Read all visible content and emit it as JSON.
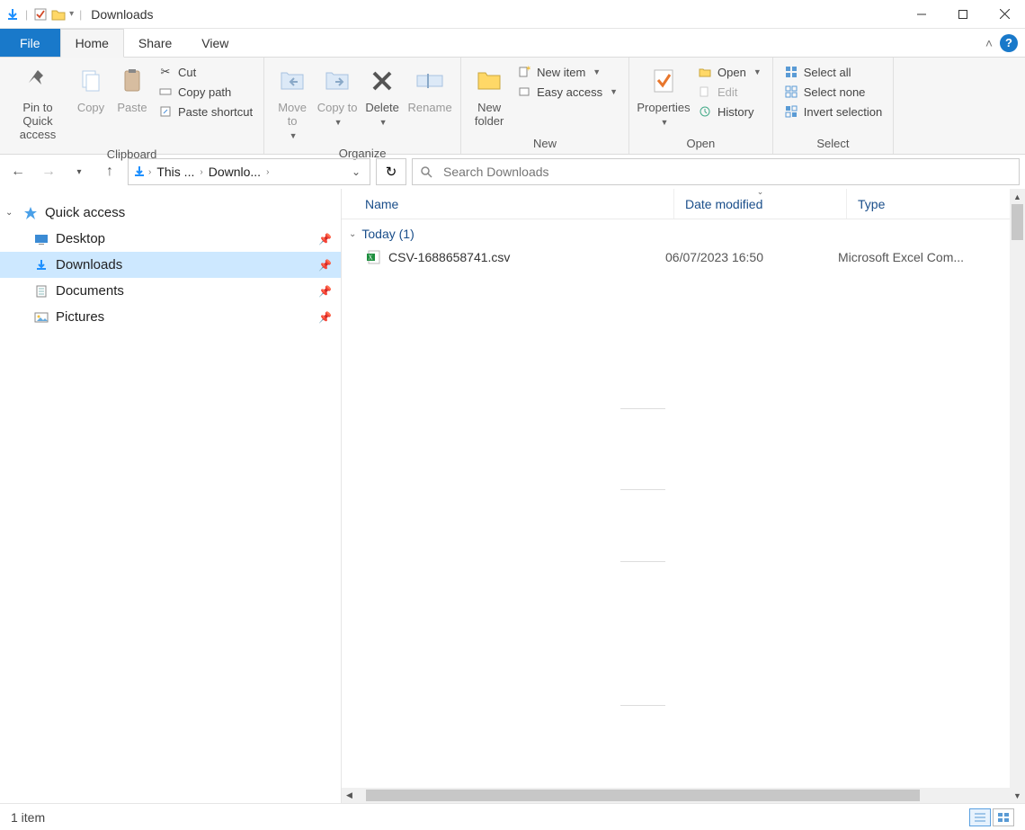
{
  "window": {
    "title": "Downloads"
  },
  "tabs": {
    "file": "File",
    "home": "Home",
    "share": "Share",
    "view": "View"
  },
  "ribbon": {
    "clipboard": {
      "label": "Clipboard",
      "pin": "Pin to Quick access",
      "copy": "Copy",
      "paste": "Paste",
      "cut": "Cut",
      "copypath": "Copy path",
      "pasteshortcut": "Paste shortcut"
    },
    "organize": {
      "label": "Organize",
      "moveto": "Move to",
      "copyto": "Copy to",
      "delete": "Delete",
      "rename": "Rename"
    },
    "new": {
      "label": "New",
      "newfolder": "New folder",
      "newitem": "New item",
      "easyaccess": "Easy access"
    },
    "open": {
      "label": "Open",
      "properties": "Properties",
      "open": "Open",
      "edit": "Edit",
      "history": "History"
    },
    "select": {
      "label": "Select",
      "selectall": "Select all",
      "selectnone": "Select none",
      "invert": "Invert selection"
    }
  },
  "breadcrumb": {
    "root": "This ...",
    "current": "Downlo..."
  },
  "search": {
    "placeholder": "Search Downloads"
  },
  "navpane": {
    "quickaccess": "Quick access",
    "desktop": "Desktop",
    "downloads": "Downloads",
    "documents": "Documents",
    "pictures": "Pictures"
  },
  "columns": {
    "name": "Name",
    "date": "Date modified",
    "type": "Type"
  },
  "group": {
    "label": "Today (1)"
  },
  "files": [
    {
      "name": "CSV-1688658741.csv",
      "date": "06/07/2023 16:50",
      "type": "Microsoft Excel Com..."
    }
  ],
  "status": {
    "count": "1 item"
  }
}
